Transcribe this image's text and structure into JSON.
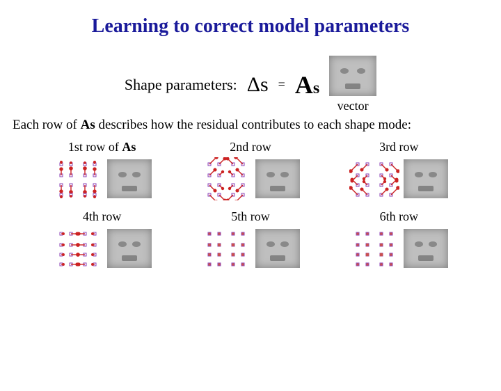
{
  "title": "Learning to correct model parameters",
  "equation": {
    "shape_params_label": "Shape parameters:",
    "delta_s": "Δs",
    "equals": "=",
    "matrix_symbol": "A",
    "matrix_sub": "s",
    "vector_label": "vector"
  },
  "explanation": {
    "pre": "Each row of ",
    "As": "As",
    "post": " describes how the residual contributes to each shape mode:"
  },
  "rows": [
    {
      "label_pre": "1st row",
      "label_of": " of ",
      "label_As": "As"
    },
    {
      "label_pre": "2nd row",
      "label_of": "",
      "label_As": ""
    },
    {
      "label_pre": "3rd row",
      "label_of": "",
      "label_As": ""
    },
    {
      "label_pre": "4th row",
      "label_of": "",
      "label_As": ""
    },
    {
      "label_pre": "5th row",
      "label_of": "",
      "label_As": ""
    },
    {
      "label_pre": "6th row",
      "label_of": "",
      "label_As": ""
    }
  ],
  "vector_patterns": [
    {
      "dx": [
        0,
        0,
        0,
        0,
        0,
        0,
        0,
        0,
        0,
        0,
        0,
        0,
        0,
        0,
        0,
        0
      ],
      "dy": [
        0,
        0,
        0,
        0,
        0,
        0,
        0,
        0,
        0,
        0,
        0,
        0,
        0,
        0,
        0,
        0
      ],
      "color": "#cc2222",
      "scales": [
        0.3,
        0.2,
        0.2,
        0.3,
        0.9,
        1.0,
        1.0,
        0.9,
        0.9,
        1.0,
        1.0,
        0.9,
        0.3,
        0.2,
        0.2,
        0.3
      ],
      "mode": "vert"
    },
    {
      "dx": [
        1,
        1,
        -1,
        -1,
        1,
        1,
        -1,
        -1,
        1,
        1,
        -1,
        -1,
        1,
        1,
        -1,
        -1
      ],
      "dy": [
        -1,
        -1,
        -1,
        -1,
        -1,
        -1,
        -1,
        -1,
        1,
        1,
        1,
        1,
        1,
        1,
        1,
        1
      ],
      "color": "#cc2222",
      "scales": [
        1,
        0.8,
        0.8,
        1,
        0.8,
        0.5,
        0.5,
        0.8,
        0.8,
        0.5,
        0.5,
        0.8,
        1,
        0.8,
        0.8,
        1
      ],
      "mode": "diag"
    },
    {
      "dx": [
        -1,
        -1,
        1,
        1,
        -1,
        -1,
        1,
        1,
        -1,
        -1,
        1,
        1,
        -1,
        -1,
        1,
        1
      ],
      "dy": [
        1,
        1,
        1,
        1,
        1,
        1,
        1,
        1,
        -1,
        -1,
        -1,
        -1,
        -1,
        -1,
        -1,
        -1
      ],
      "color": "#cc2222",
      "scales": [
        1,
        0.8,
        0.8,
        1,
        0.8,
        0.5,
        0.5,
        0.8,
        0.8,
        0.5,
        0.5,
        0.8,
        1,
        0.8,
        0.8,
        1
      ],
      "mode": "diag"
    },
    {
      "dx": [
        1,
        1,
        -1,
        -1,
        1,
        1,
        -1,
        -1,
        1,
        1,
        -1,
        -1,
        1,
        1,
        -1,
        -1
      ],
      "dy": [
        0,
        0,
        0,
        0,
        0,
        0,
        0,
        0,
        0,
        0,
        0,
        0,
        0,
        0,
        0,
        0
      ],
      "color": "#cc2222",
      "scales": [
        0.3,
        0.9,
        0.9,
        0.3,
        0.3,
        1.0,
        1.0,
        0.3,
        0.3,
        1.0,
        1.0,
        0.3,
        0.3,
        0.9,
        0.9,
        0.3
      ],
      "mode": "horiz"
    },
    {
      "dx": [
        0,
        0,
        0,
        0,
        0,
        0,
        0,
        0,
        0,
        0,
        0,
        0,
        0,
        0,
        0,
        0
      ],
      "dy": [
        0,
        0,
        0,
        0,
        0,
        0,
        0,
        0,
        0,
        0,
        0,
        0,
        0,
        0,
        0,
        0
      ],
      "color": "#c95050",
      "scales": [
        0.15,
        0.15,
        0.15,
        0.15,
        0.3,
        0.6,
        0.6,
        0.3,
        0.3,
        0.6,
        0.6,
        0.3,
        0.15,
        0.15,
        0.15,
        0.15
      ],
      "mode": "dot"
    },
    {
      "dx": [
        0,
        0,
        0,
        0,
        0,
        0,
        0,
        0,
        0,
        0,
        0,
        0,
        0,
        0,
        0,
        0
      ],
      "dy": [
        0,
        0,
        0,
        0,
        0,
        0,
        0,
        0,
        0,
        0,
        0,
        0,
        0,
        0,
        0,
        0
      ],
      "color": "#c95050",
      "scales": [
        0.15,
        0.15,
        0.15,
        0.15,
        0.15,
        0.5,
        0.5,
        0.15,
        0.15,
        0.8,
        0.8,
        0.15,
        0.15,
        0.15,
        0.15,
        0.15
      ],
      "mode": "dot"
    }
  ]
}
